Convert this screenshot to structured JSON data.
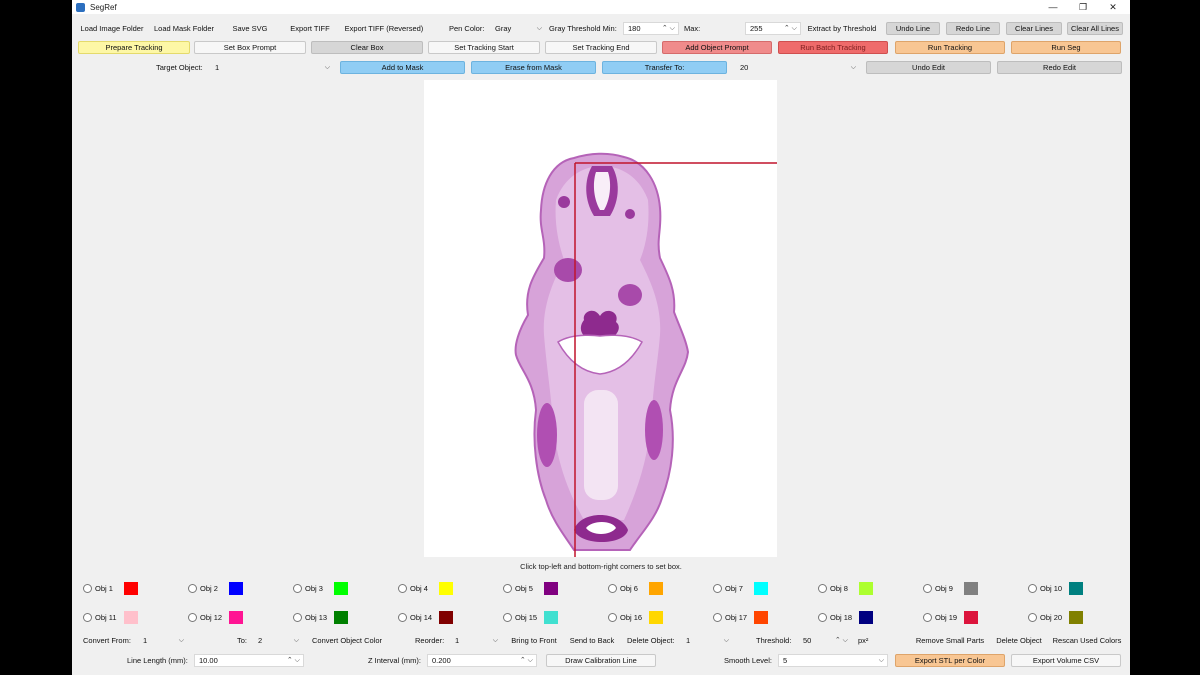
{
  "window": {
    "title": "SegRef",
    "minimize": "—",
    "restore": "❐",
    "close": "✕"
  },
  "toolbar1": {
    "load_image_folder": "Load Image Folder",
    "load_mask_folder": "Load Mask Folder",
    "save_svg": "Save SVG",
    "export_tiff": "Export TIFF",
    "export_tiff_reversed": "Export TIFF (Reversed)",
    "pen_color_label": "Pen Color:",
    "pen_color_value": "Gray",
    "gray_threshold_min_label": "Gray Threshold Min:",
    "gray_threshold_min_value": "180",
    "max_label": "Max:",
    "max_value": "255",
    "extract_by_threshold": "Extract by Threshold",
    "undo_line": "Undo Line",
    "redo_line": "Redo Line",
    "clear_lines": "Clear Lines",
    "clear_all_lines": "Clear All Lines"
  },
  "toolbar2": {
    "prepare_tracking": "Prepare Tracking",
    "set_box_prompt": "Set Box Prompt",
    "clear_box": "Clear Box",
    "set_tracking_start": "Set Tracking Start",
    "set_tracking_end": "Set Tracking End",
    "add_object_prompt": "Add Object Prompt",
    "run_batch_tracking": "Run Batch Tracking",
    "run_tracking": "Run Tracking",
    "run_seg": "Run Seg"
  },
  "toolbar3": {
    "target_object_label": "Target Object:",
    "target_object_value": "1",
    "add_to_mask": "Add to Mask",
    "erase_from_mask": "Erase from Mask",
    "transfer_to": "Transfer To:",
    "transfer_to_value": "20",
    "undo_edit": "Undo Edit",
    "redo_edit": "Redo Edit"
  },
  "canvas": {
    "hint": "Click top-left and bottom-right corners to set box."
  },
  "objects": [
    {
      "label": "Obj 1",
      "color": "#ff0000"
    },
    {
      "label": "Obj 2",
      "color": "#0000ff"
    },
    {
      "label": "Obj 3",
      "color": "#00ff00"
    },
    {
      "label": "Obj 4",
      "color": "#ffff00"
    },
    {
      "label": "Obj 5",
      "color": "#800080"
    },
    {
      "label": "Obj 6",
      "color": "#ffa500"
    },
    {
      "label": "Obj 7",
      "color": "#00ffff"
    },
    {
      "label": "Obj 8",
      "color": "#adff2f"
    },
    {
      "label": "Obj 9",
      "color": "#808080"
    },
    {
      "label": "Obj 10",
      "color": "#008080"
    },
    {
      "label": "Obj 11",
      "color": "#ffc0cb"
    },
    {
      "label": "Obj 12",
      "color": "#ff1493"
    },
    {
      "label": "Obj 13",
      "color": "#008000"
    },
    {
      "label": "Obj 14",
      "color": "#800000"
    },
    {
      "label": "Obj 15",
      "color": "#40e0d0"
    },
    {
      "label": "Obj 16",
      "color": "#ffd700"
    },
    {
      "label": "Obj 17",
      "color": "#ff4500"
    },
    {
      "label": "Obj 18",
      "color": "#000080"
    },
    {
      "label": "Obj 19",
      "color": "#dc143c"
    },
    {
      "label": "Obj 20",
      "color": "#808000"
    }
  ],
  "bottom1": {
    "convert_from_label": "Convert From:",
    "convert_from_value": "1",
    "to_label": "To:",
    "to_value": "2",
    "convert_object_color": "Convert Object Color",
    "reorder_label": "Reorder:",
    "reorder_value": "1",
    "bring_to_front": "Bring to Front",
    "send_to_back": "Send to Back",
    "delete_object_label": "Delete Object:",
    "delete_object_value": "1",
    "threshold_label": "Threshold:",
    "threshold_value": "50",
    "threshold_unit": "px²",
    "remove_small_parts": "Remove Small Parts",
    "delete_object": "Delete Object",
    "rescan_used_colors": "Rescan Used Colors"
  },
  "bottom2": {
    "line_length_label": "Line Length (mm):",
    "line_length_value": "10.00",
    "z_interval_label": "Z Interval (mm):",
    "z_interval_value": "0.200",
    "draw_calibration_line": "Draw Calibration Line",
    "smooth_level_label": "Smooth Level:",
    "smooth_level_value": "5",
    "export_stl_per_color": "Export STL per Color",
    "export_volume_csv": "Export Volume CSV"
  },
  "colors": {
    "box_outline": "#c0142c",
    "tissue": "#c46fc4",
    "tissue_dark": "#8e2a8e"
  }
}
